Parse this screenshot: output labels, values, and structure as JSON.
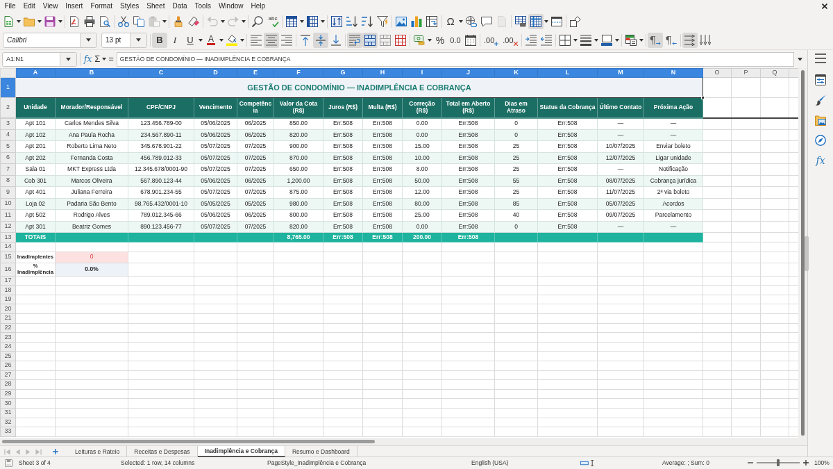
{
  "menu_bar": [
    "File",
    "Edit",
    "View",
    "Insert",
    "Format",
    "Styles",
    "Sheet",
    "Data",
    "Tools",
    "Window",
    "Help"
  ],
  "standard_toolbar": {
    "paste_disabled": true,
    "undo_disabled": true,
    "redo_disabled": true,
    "spelling_label": "abc",
    "special_character_label": "Ω",
    "headers_footers_disabled": true,
    "freeze_on": true
  },
  "formatting_toolbar": {
    "font_name": "Calibri",
    "font_size": "13 pt",
    "bold": {
      "label": "B",
      "on": true
    },
    "italic": {
      "label": "I",
      "on": false
    },
    "underline": {
      "label": "U",
      "on": false
    },
    "font_color": {
      "label": "A"
    },
    "align_left": {
      "on": false
    },
    "align_center": {
      "on": true
    },
    "align_right": {
      "on": false
    },
    "align_top": {
      "on": false
    },
    "align_middle": {
      "on": true
    },
    "align_bottom": {
      "on": false
    },
    "wrap_text": {
      "on": true
    },
    "merge_and_center": {
      "on": true
    },
    "percent": {
      "label": "%"
    },
    "number_format": {
      "label": "0.0"
    },
    "add_decimal": {
      "label": ".00"
    },
    "delete_decimal": {
      "label": ".00"
    },
    "left_to_right": {
      "label": "¶",
      "on": true
    },
    "right_to_left": {
      "label": "¶",
      "on": false
    },
    "text_horizontal": {
      "on": true
    },
    "text_vertical": {
      "on": false
    }
  },
  "formula_bar": {
    "name_box": "A1:N1",
    "function_wizard": "fx",
    "sum": "Σ",
    "equals": "=",
    "content": "GESTÃO DE CONDOMÍNIO — INADIMPLÊNCIA E COBRANÇA"
  },
  "sheet": {
    "columns": [
      {
        "label": "A",
        "selected": true
      },
      {
        "label": "B",
        "selected": true
      },
      {
        "label": "C",
        "selected": true
      },
      {
        "label": "D",
        "selected": true
      },
      {
        "label": "E",
        "selected": true
      },
      {
        "label": "F",
        "selected": true
      },
      {
        "label": "G",
        "selected": true
      },
      {
        "label": "H",
        "selected": true
      },
      {
        "label": "I",
        "selected": true
      },
      {
        "label": "J",
        "selected": true
      },
      {
        "label": "K",
        "selected": true
      },
      {
        "label": "L",
        "selected": true
      },
      {
        "label": "M",
        "selected": true
      },
      {
        "label": "N",
        "selected": true
      },
      {
        "label": "O",
        "selected": false
      },
      {
        "label": "P",
        "selected": false
      },
      {
        "label": "Q",
        "selected": false
      }
    ],
    "rows": [
      {
        "label": "1",
        "selected": true,
        "kind": "title",
        "title": "GESTÃO DE CONDOMÍNIO — INADIMPLÊNCIA E COBRANÇA"
      },
      {
        "label": "2",
        "selected": false,
        "kind": "header",
        "cells": [
          "Unidade",
          "Morador/Responsável",
          "CPF/CNPJ",
          "Vencimento",
          "Competência",
          "Valor da Cota (R$)",
          "Juros (R$)",
          "Multa (R$)",
          "Correção (R$)",
          "Total em Aberto (R$)",
          "Dias em Atraso",
          "Status da Cobrança",
          "Último Contato",
          "Próxima Ação"
        ]
      },
      {
        "label": "3",
        "selected": false,
        "kind": "data",
        "shaded": false,
        "cells": [
          "Apt 101",
          "Carlos Mendes Silva",
          "123.456.789-00",
          "05/06/2025",
          "06/2025",
          "850.00",
          "Err:508",
          "Err:508",
          "0.00",
          "Err:508",
          "0",
          "Err:508",
          "—",
          "—"
        ]
      },
      {
        "label": "4",
        "selected": false,
        "kind": "data",
        "shaded": true,
        "cells": [
          "Apt 102",
          "Ana Paula Rocha",
          "234.567.890-11",
          "05/06/2025",
          "06/2025",
          "820.00",
          "Err:508",
          "Err:508",
          "0.00",
          "Err:508",
          "0",
          "Err:508",
          "—",
          "—"
        ]
      },
      {
        "label": "5",
        "selected": false,
        "kind": "data",
        "shaded": false,
        "cells": [
          "Apt 201",
          "Roberto Lima Neto",
          "345.678.901-22",
          "05/07/2025",
          "07/2025",
          "900.00",
          "Err:508",
          "Err:508",
          "15.00",
          "Err:508",
          "25",
          "Err:508",
          "10/07/2025",
          "Enviar boleto"
        ]
      },
      {
        "label": "6",
        "selected": false,
        "kind": "data",
        "shaded": true,
        "cells": [
          "Apt 202",
          "Fernanda Costa",
          "456.789.012-33",
          "05/07/2025",
          "07/2025",
          "870.00",
          "Err:508",
          "Err:508",
          "10.00",
          "Err:508",
          "25",
          "Err:508",
          "12/07/2025",
          "Ligar unidade"
        ]
      },
      {
        "label": "7",
        "selected": false,
        "kind": "data",
        "shaded": false,
        "cells": [
          "Sala 01",
          "MKT Express Ltda",
          "12.345.678/0001-90",
          "05/07/2025",
          "07/2025",
          "650.00",
          "Err:508",
          "Err:508",
          "8.00",
          "Err:508",
          "25",
          "Err:508",
          "—",
          "Notificação"
        ]
      },
      {
        "label": "8",
        "selected": false,
        "kind": "data",
        "shaded": true,
        "cells": [
          "Cob 301",
          "Marcos Oliveira",
          "567.890.123-44",
          "05/06/2025",
          "06/2025",
          "1,200.00",
          "Err:508",
          "Err:508",
          "50.00",
          "Err:508",
          "55",
          "Err:508",
          "08/07/2025",
          "Cobrança jurídica"
        ]
      },
      {
        "label": "9",
        "selected": false,
        "kind": "data",
        "shaded": false,
        "cells": [
          "Apt 401",
          "Juliana Ferreira",
          "678.901.234-55",
          "05/07/2025",
          "07/2025",
          "875.00",
          "Err:508",
          "Err:508",
          "12.00",
          "Err:508",
          "25",
          "Err:508",
          "11/07/2025",
          "2ª via boleto"
        ]
      },
      {
        "label": "10",
        "selected": false,
        "kind": "data",
        "shaded": true,
        "cells": [
          "Loja 02",
          "Padaria São Bento",
          "98.765.432/0001-10",
          "05/05/2025",
          "05/2025",
          "980.00",
          "Err:508",
          "Err:508",
          "80.00",
          "Err:508",
          "85",
          "Err:508",
          "05/07/2025",
          "Acordos"
        ]
      },
      {
        "label": "11",
        "selected": false,
        "kind": "data",
        "shaded": false,
        "cells": [
          "Apt 502",
          "Rodrigo Alves",
          "789.012.345-66",
          "05/06/2025",
          "06/2025",
          "800.00",
          "Err:508",
          "Err:508",
          "25.00",
          "Err:508",
          "40",
          "Err:508",
          "09/07/2025",
          "Parcelamento"
        ]
      },
      {
        "label": "12",
        "selected": false,
        "kind": "data",
        "shaded": true,
        "cells": [
          "Apt 301",
          "Beatriz Gomes",
          "890.123.456-77",
          "05/07/2025",
          "07/2025",
          "820.00",
          "Err:508",
          "Err:508",
          "0.00",
          "Err:508",
          "0",
          "Err:508",
          "—",
          "—"
        ]
      },
      {
        "label": "13",
        "selected": false,
        "kind": "totals",
        "caption": "TOTAIS",
        "values": [
          "8,765.00",
          "Err:508",
          "Err:508",
          "200.00",
          "Err:508"
        ]
      },
      {
        "label": "14",
        "selected": false,
        "kind": "blank"
      },
      {
        "label": "15",
        "selected": false,
        "kind": "metric_alert",
        "caption": "Inadimplentes",
        "value": "0"
      },
      {
        "label": "16",
        "selected": false,
        "kind": "metric",
        "caption": "% Inadimplência",
        "value": "0.0%"
      },
      {
        "label": "17",
        "selected": false,
        "kind": "blank"
      },
      {
        "label": "18",
        "selected": false,
        "kind": "blank"
      },
      {
        "label": "19",
        "selected": false,
        "kind": "blank"
      },
      {
        "label": "20",
        "selected": false,
        "kind": "blank"
      },
      {
        "label": "21",
        "selected": false,
        "kind": "blank"
      },
      {
        "label": "22",
        "selected": false,
        "kind": "blank"
      },
      {
        "label": "23",
        "selected": false,
        "kind": "blank"
      },
      {
        "label": "24",
        "selected": false,
        "kind": "blank"
      },
      {
        "label": "25",
        "selected": false,
        "kind": "blank"
      },
      {
        "label": "26",
        "selected": false,
        "kind": "blank"
      },
      {
        "label": "27",
        "selected": false,
        "kind": "blank"
      },
      {
        "label": "28",
        "selected": false,
        "kind": "blank"
      },
      {
        "label": "29",
        "selected": false,
        "kind": "blank"
      },
      {
        "label": "30",
        "selected": false,
        "kind": "blank"
      },
      {
        "label": "31",
        "selected": false,
        "kind": "blank"
      },
      {
        "label": "32",
        "selected": false,
        "kind": "blank"
      },
      {
        "label": "33",
        "selected": false,
        "kind": "blank"
      }
    ]
  },
  "sidebar": {
    "functions_label": "fx"
  },
  "sheet_tabs": {
    "navigation_disabled": true,
    "tabs": [
      {
        "label": "Leituras e Rateio",
        "selected": false
      },
      {
        "label": "Receitas e Despesas",
        "selected": false
      },
      {
        "label": "Inadimplência e Cobrança",
        "selected": true
      },
      {
        "label": "Resumo e Dashboard",
        "selected": false
      }
    ]
  },
  "status_bar": {
    "sheet_position": "Sheet 3 of 4",
    "selection": "Selected: 1 row, 14 columns",
    "page_style": "PageStyle_Inadimplência e Cobrança",
    "language": "English (USA)",
    "statistics": "Average: ; Sum: 0",
    "zoom": {
      "level": 0.5,
      "reading": "100%"
    }
  }
}
